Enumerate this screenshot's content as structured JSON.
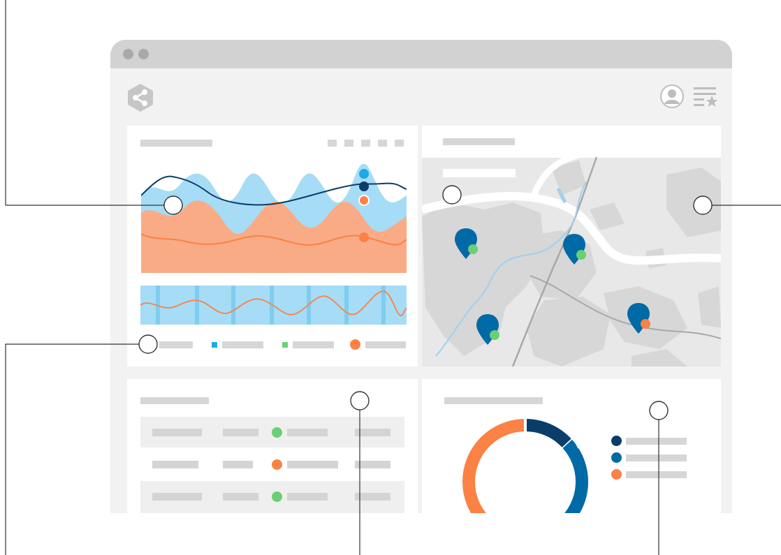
{
  "colors": {
    "navy": "#0b3d6b",
    "blue": "#006aa7",
    "light_blue": "#a6dcf5",
    "sky": "#1da9e8",
    "orange": "#fb8145",
    "salmon": "#f9ab86",
    "green": "#6bcf73",
    "placeholder_gray": "#d6d6d6"
  },
  "icons": {
    "logo": "share-hexagon-icon",
    "user": "user-avatar-icon",
    "menu": "starred-list-icon"
  },
  "chart_panel": {
    "legend_items": [
      {
        "color": "#1da9e8",
        "shape": "square"
      },
      {
        "color": "#6bcf73",
        "shape": "square"
      },
      {
        "color": "#fb8145",
        "shape": "circle"
      }
    ]
  },
  "map_panel": {
    "pins": [
      {
        "color": "#006aa7",
        "badge": "#6bcf73"
      },
      {
        "color": "#006aa7",
        "badge": "#6bcf73"
      },
      {
        "color": "#006aa7",
        "badge": "#6bcf73"
      },
      {
        "color": "#006aa7",
        "badge": "#fb8145"
      }
    ]
  },
  "table_panel": {
    "rows": [
      {
        "status": "#6bcf73",
        "shaded": true
      },
      {
        "status": "#fb8145",
        "shaded": false
      },
      {
        "status": "#6bcf73",
        "shaded": true
      }
    ]
  },
  "donut_panel": {
    "segments": [
      {
        "color": "#0b3d6b",
        "fraction": 0.13
      },
      {
        "color": "#006aa7",
        "fraction": 0.37
      },
      {
        "color": "#fb8145",
        "fraction": 0.5
      }
    ],
    "legend": [
      "#0b3d6b",
      "#006aa7",
      "#fb8145"
    ]
  },
  "callouts": 6
}
